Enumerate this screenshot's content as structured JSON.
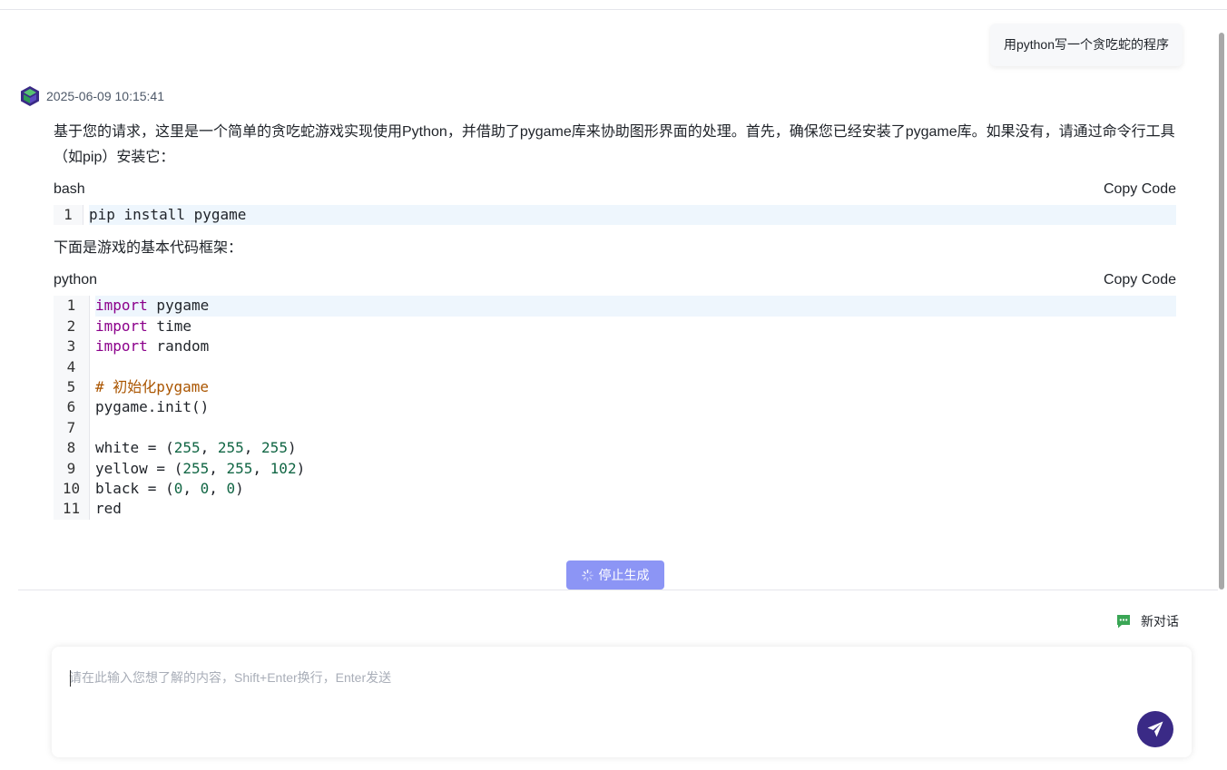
{
  "user_message": "用python写一个贪吃蛇的程序",
  "bot": {
    "timestamp": "2025-06-09 10:15:41",
    "intro": "基于您的请求，这里是一个简单的贪吃蛇游戏实现使用Python，并借助了pygame库来协助图形界面的处理。首先，确保您已经安装了pygame库。如果没有，请通过命令行工具（如pip）安装它：",
    "code_blocks": [
      {
        "lang": "bash",
        "copy_label": "Copy Code",
        "lines": [
          "pip install pygame"
        ]
      },
      {
        "lang": "python",
        "copy_label": "Copy Code",
        "lines": [
          "import pygame",
          "import time",
          "import random",
          "",
          "# 初始化pygame",
          "pygame.init()",
          "",
          "white = (255, 255, 255)",
          "yellow = (255, 255, 102)",
          "black = (0, 0, 0)",
          "red"
        ]
      }
    ],
    "middle_text": "下面是游戏的基本代码框架："
  },
  "stop_button_label": "停止生成",
  "new_chat_label": "新对话",
  "input": {
    "placeholder": "请在此输入您想了解的内容，Shift+Enter换行，Enter发送",
    "value": ""
  },
  "colors": {
    "accent": "#3a2a86",
    "stop_button": "#8c95f5",
    "new_chat_icon": "#3aa655"
  }
}
